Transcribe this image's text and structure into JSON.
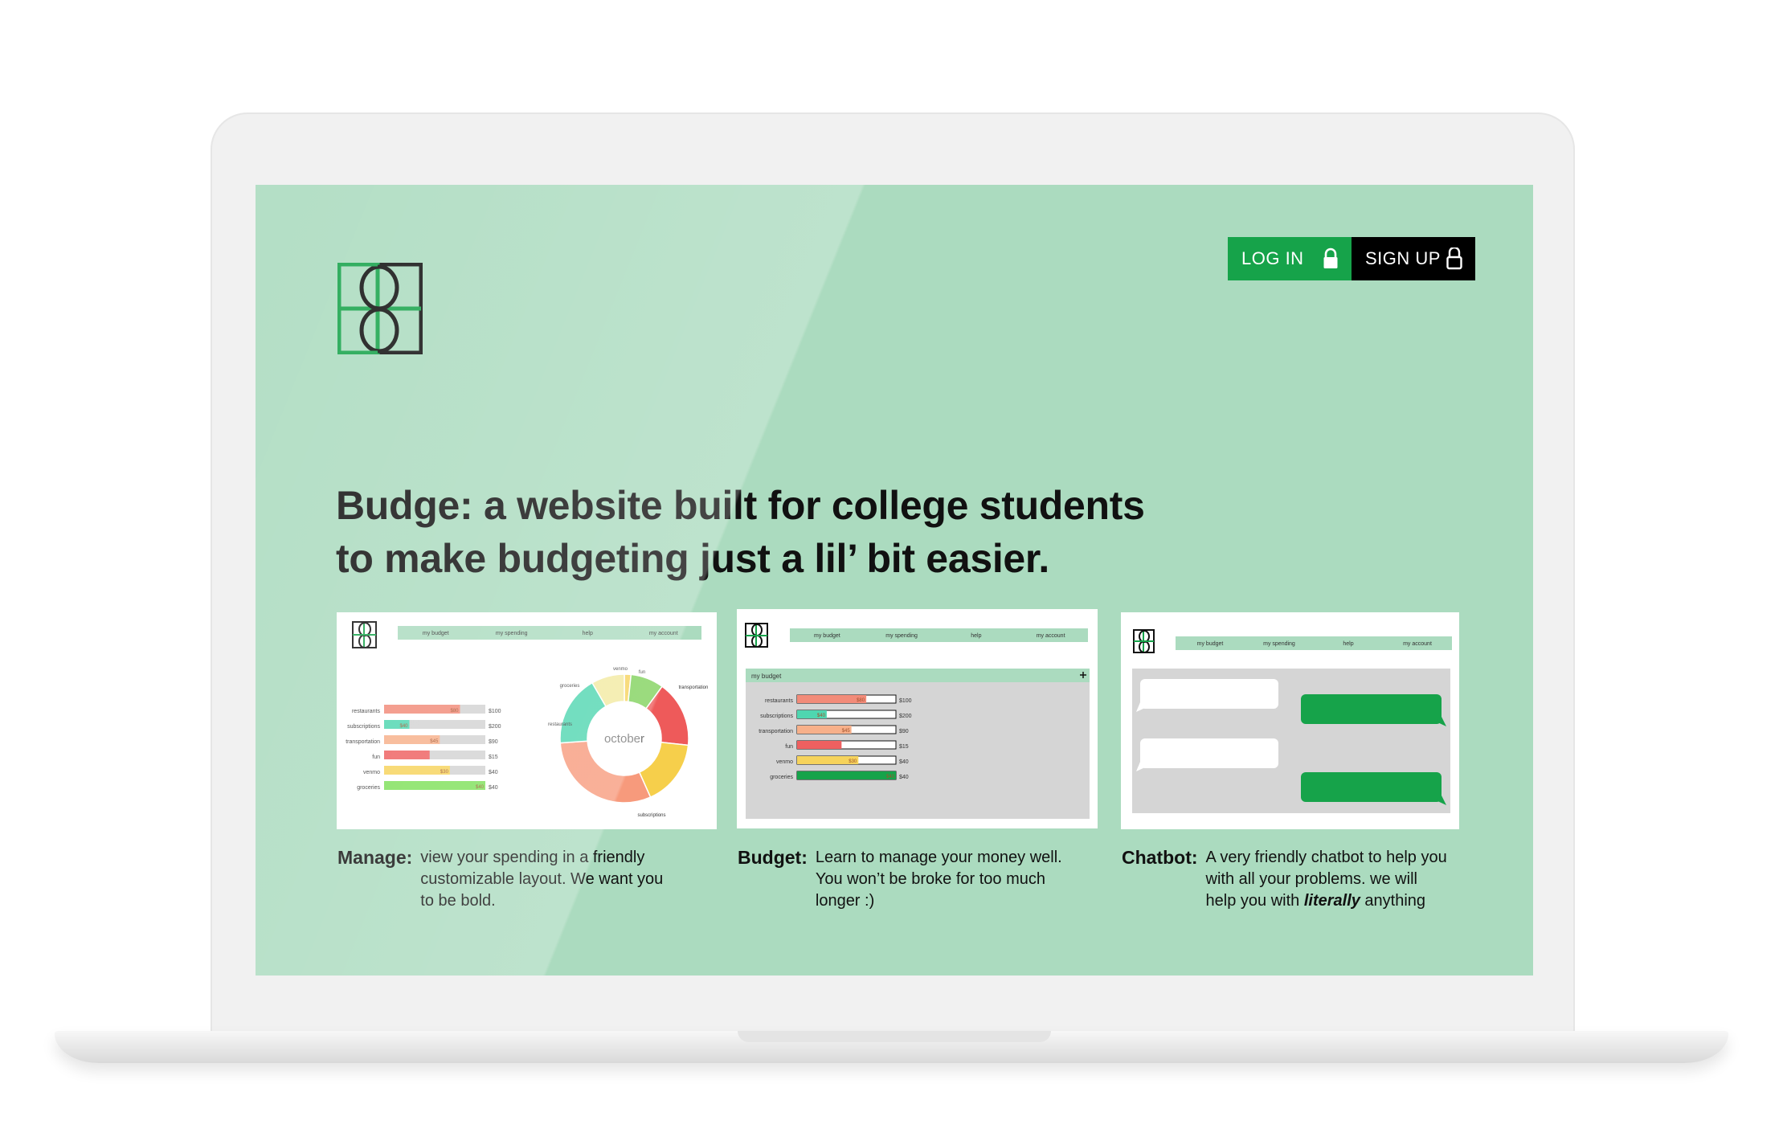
{
  "brand": {
    "logo_icon": "budge-logo-icon",
    "green": "#16a34a",
    "screen_bg": "#abdbbf"
  },
  "auth": {
    "login_label": "LOG IN",
    "signup_label": "SIGN UP",
    "lock_icon": "lock-icon"
  },
  "hero": {
    "line1": "Budge: a website built for college students",
    "line2": "to make budgeting just a lil’ bit easier."
  },
  "preview_nav": [
    "my budget",
    "my spending",
    "help",
    "my account"
  ],
  "manage_preview": {
    "categories": [
      {
        "label": "restaurants",
        "amount": "$100",
        "fill": 0.75,
        "color": "#f28b79",
        "inner": "$80"
      },
      {
        "label": "subscriptions",
        "amount": "$200",
        "fill": 0.25,
        "color": "#4fd6b0",
        "inner": "$40"
      },
      {
        "label": "transportation",
        "amount": "$90",
        "fill": 0.55,
        "color": "#f7b08a",
        "inner": "$45"
      },
      {
        "label": "fun",
        "amount": "$15",
        "fill": 0.45,
        "color": "#ee6060",
        "inner": ""
      },
      {
        "label": "venmo",
        "amount": "$40",
        "fill": 0.65,
        "color": "#f6d35b",
        "inner": "$30"
      },
      {
        "label": "groceries",
        "amount": "$40",
        "fill": 1.0,
        "color": "#7fe05a",
        "inner": "$40"
      }
    ],
    "donut_center": "october",
    "donut_labels": [
      "venmo",
      "fun",
      "transportation",
      "groceries",
      "restaurants",
      "subscriptions"
    ]
  },
  "budget_preview": {
    "header": "my budget",
    "add_icon": "plus-icon",
    "categories": [
      {
        "label": "restaurants",
        "amount": "$100",
        "fill": 0.7,
        "color": "#f28b79",
        "inner": "$80"
      },
      {
        "label": "subscriptions",
        "amount": "$200",
        "fill": 0.3,
        "color": "#4fd6b0",
        "inner": "$40"
      },
      {
        "label": "transportation",
        "amount": "$90",
        "fill": 0.55,
        "color": "#f7b08a",
        "inner": "$45"
      },
      {
        "label": "fun",
        "amount": "$15",
        "fill": 0.45,
        "color": "#ee6060",
        "inner": ""
      },
      {
        "label": "venmo",
        "amount": "$40",
        "fill": 0.62,
        "color": "#f6d35b",
        "inner": "$30"
      },
      {
        "label": "groceries",
        "amount": "$40",
        "fill": 1.0,
        "color": "#16a34a",
        "inner": "$40"
      }
    ]
  },
  "features": [
    {
      "title": "Manage:",
      "lines": [
        "view your spending in a friendly",
        "customizable layout. We want you",
        "to be bold."
      ]
    },
    {
      "title": "Budget:",
      "lines": [
        "Learn to manage your money well.",
        "You won’t be broke for too much",
        "longer :)"
      ]
    },
    {
      "title": "Chatbot:",
      "lines": [
        "A very friendly chatbot to help you",
        "with all your problems. we will"
      ],
      "line3_pre": "help you with ",
      "line3_em": "literally",
      "line3_post": " anything"
    }
  ]
}
